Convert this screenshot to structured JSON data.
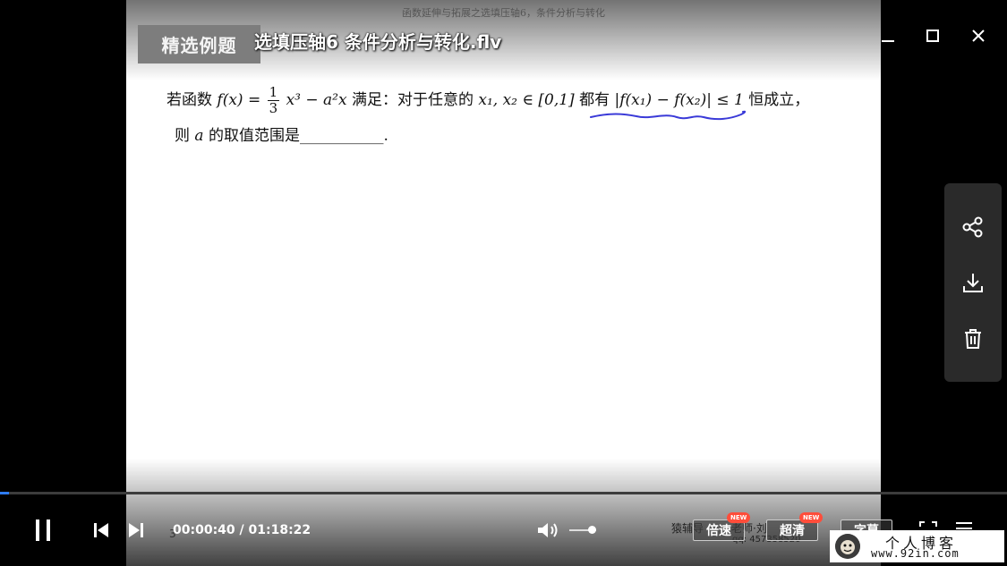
{
  "window": {
    "title": "选填压轴6 条件分析与转化.flv",
    "controls": {
      "minimize": "minimize-icon",
      "maximize": "maximize-icon",
      "close": "close-icon"
    }
  },
  "slide": {
    "header": "函数延伸与拓展之选填压轴6，条件分析与转化",
    "label": "精选例题",
    "problem": {
      "line1_a": "若函数",
      "fx": "f(x) =",
      "frac_num": "1",
      "frac_den": "3",
      "line1_b": "x³ − a²x",
      "line1_c": "满足：对于任意的",
      "vars": "x₁, x₂ ∈ [0,1]",
      "line1_d": "都有",
      "abs": "|f(x₁) − f(x₂)| ≤ 1",
      "line1_e": "恒成立，",
      "line2_a": "则",
      "line2_var": "a",
      "line2_b": "的取值范围是___________."
    }
  },
  "side_panel": [
    {
      "name": "share-icon"
    },
    {
      "name": "download-icon"
    },
    {
      "name": "trash-icon"
    }
  ],
  "player": {
    "progress_fraction": 0.0085,
    "time_display": "00:00:40 / 01:18:22",
    "volume_fraction": 0.7,
    "speed_label": "倍速",
    "quality_label": "超清",
    "subtitle_label": "字幕",
    "new_badge": "NEW",
    "page_mark": "3",
    "watermark_a": "猿辅导",
    "watermark_b": "老师·刘",
    "watermark_qq": "qq: 457358520"
  },
  "blog_badge": {
    "title": "个人博客",
    "url": "www.92in.com"
  },
  "colors": {
    "accent": "#2e7cf6",
    "annotation_ink": "#3a3ad8",
    "badge": "#ff4d3a"
  }
}
